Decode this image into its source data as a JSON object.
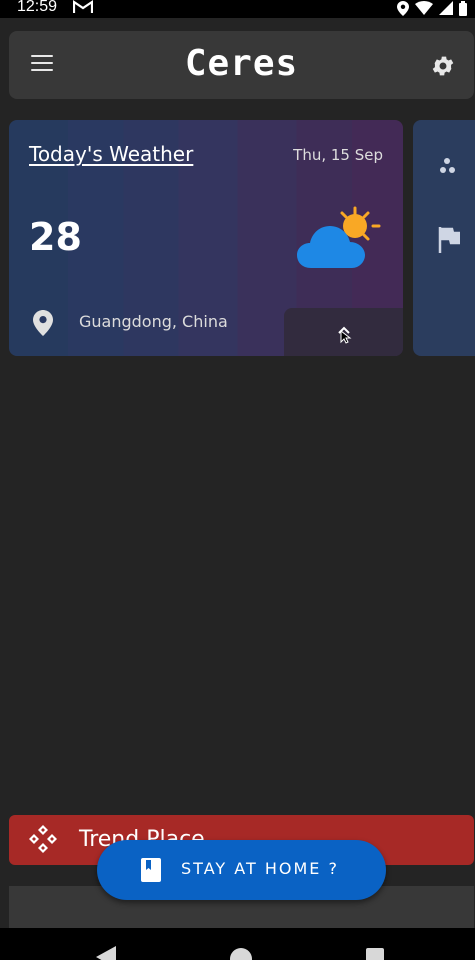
{
  "status_bar": {
    "time": "12:59"
  },
  "app_bar": {
    "title": "Ceres"
  },
  "weather_card": {
    "title": "Today's Weather",
    "date": "Thu, 15 Sep",
    "temperature": "28",
    "location": "Guangdong, China"
  },
  "trend_banner": {
    "label": "Trend Place"
  },
  "fab": {
    "label": "STAY AT HOME ?"
  },
  "colors": {
    "background": "#242424",
    "app_bar": "#383838",
    "trend_banner": "#a72926",
    "fab": "#0a62c4",
    "cloud": "#1e88e5",
    "sun": "#f9a825"
  },
  "icons": {
    "status_left": [
      "gmail-icon"
    ],
    "status_right": [
      "location-icon",
      "wifi-icon",
      "signal-icon",
      "battery-icon"
    ],
    "app_bar": [
      "menu-icon",
      "settings-icon"
    ],
    "weather_card": [
      "partly-cloudy-icon",
      "location-pin-icon",
      "expand-icon"
    ],
    "side_card": [
      "dots-icon",
      "flag-icon"
    ],
    "trend_banner": [
      "trend-icon"
    ],
    "fab": [
      "book-icon"
    ]
  }
}
